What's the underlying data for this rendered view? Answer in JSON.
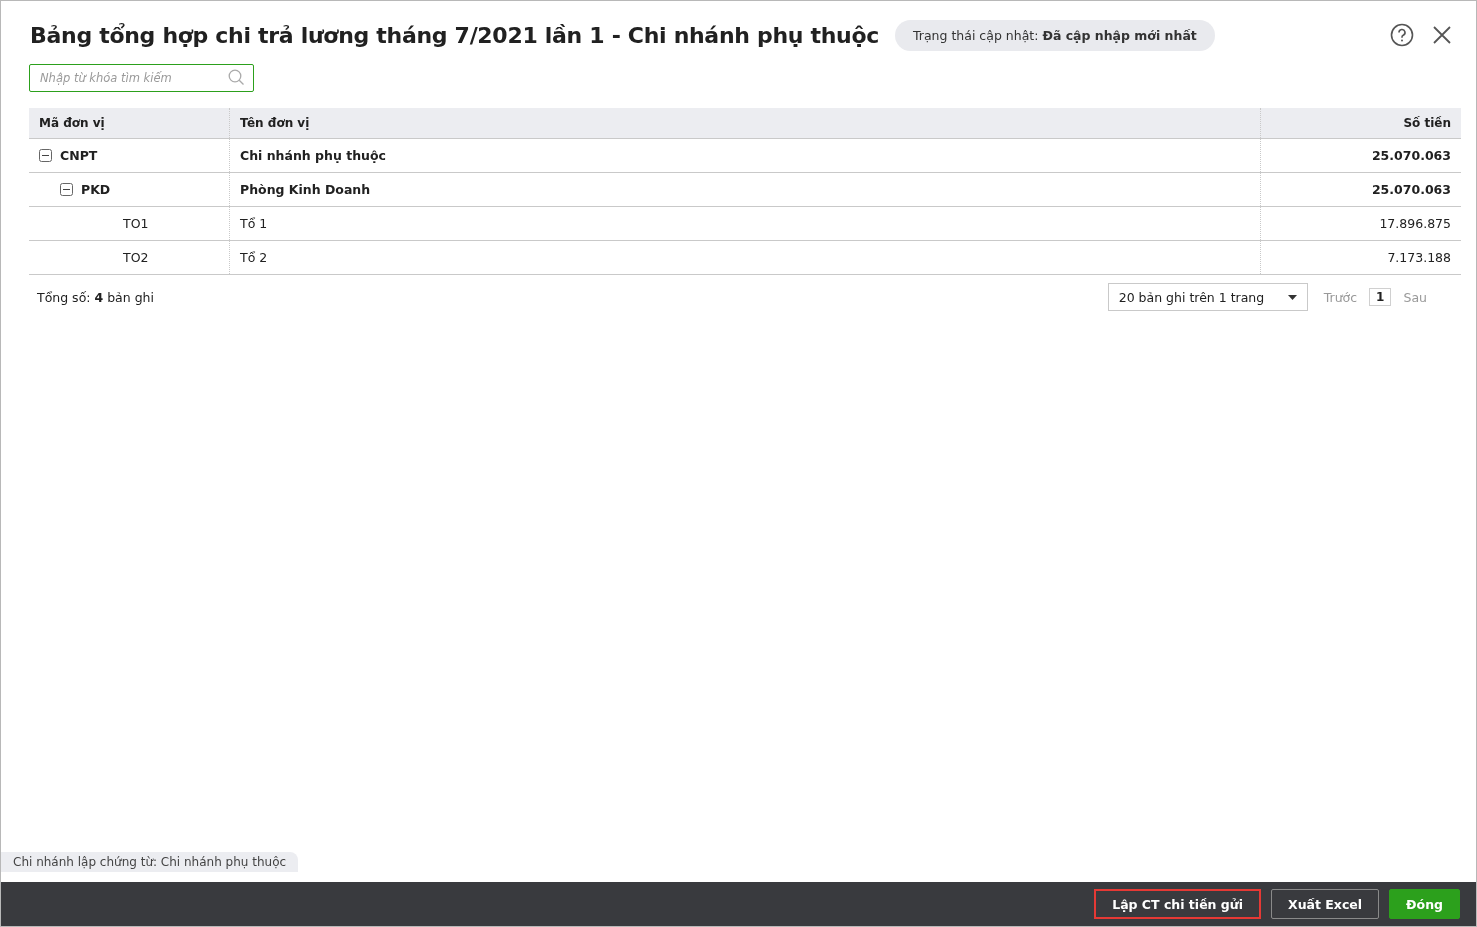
{
  "dialog": {
    "title": "Bảng tổng hợp chi trả lương tháng 7/2021 lần 1 - Chi nhánh phụ thuộc",
    "status": "Trạng thái cập nhật: **Đã cập nhập mới nhất**"
  },
  "search": {
    "placeholder": "Nhập từ khóa tìm kiếm"
  },
  "table": {
    "columns": [
      "Mã đơn vị",
      "Tên đơn vị",
      "Số tiền"
    ],
    "rows": [
      {
        "code": "CNPT",
        "name": "Chi nhánh phụ thuộc",
        "amount": "25.070.063",
        "expanded": true,
        "children": [
          {
            "code": "PKD",
            "name": "Phòng Kinh Doanh",
            "amount": "25.070.063",
            "expanded": true,
            "children": [
              {
                "code": "TO1",
                "name": "Tổ 1",
                "amount": "17.896.875"
              },
              {
                "code": "TO2",
                "name": "Tổ 2",
                "amount": "7.173.188"
              }
            ]
          }
        ]
      }
    ]
  },
  "pager": {
    "total": "Tổng số: **4** bản ghi",
    "page_size": "20 bản ghi trên 1 trang",
    "prev": "Trước",
    "page": "1",
    "next": "Sau"
  },
  "branch_note": "Chi nhánh lập chứng từ: Chi nhánh phụ thuộc",
  "buttons": [
    {
      "label": "Lập CT chi tiền gửi",
      "kind": "outline",
      "highlighted": true
    },
    {
      "label": "Xuất Excel",
      "kind": "outline",
      "highlighted": false
    },
    {
      "label": "Đóng",
      "kind": "primary",
      "highlighted": false
    }
  ]
}
